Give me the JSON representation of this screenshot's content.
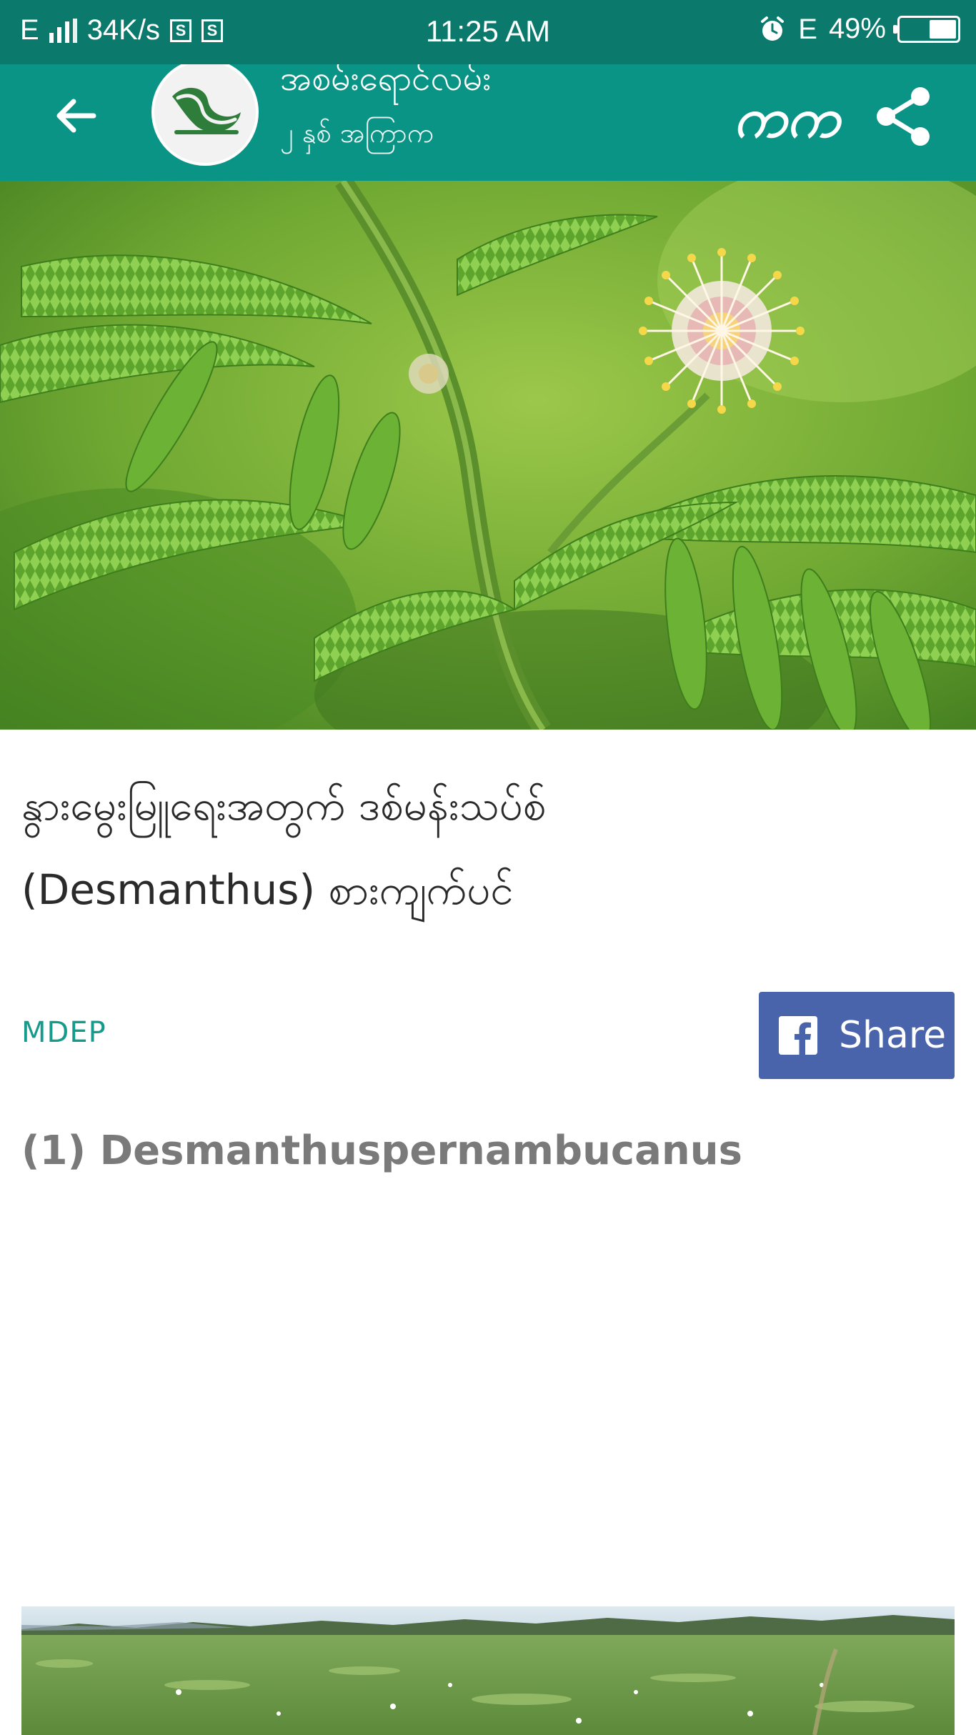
{
  "status_bar": {
    "network_type": "E",
    "speed": "34K/s",
    "sim_label": "S",
    "time": "11:25 AM",
    "data_type": "E",
    "battery_percent": "49%",
    "battery_level": 0.49
  },
  "header": {
    "channel_name": "အစမ်းရောင်လမ်း",
    "channel_meta": "၂ နှစ် အကြာက",
    "font_toggle_label": "ကက"
  },
  "article": {
    "title_line_1": "နွားမွေးမြူရေးအတွက် ဒစ်မန်းသပ်စ်",
    "title_line_2": "(Desmanthus) စားကျက်ပင်",
    "source": "MDEP",
    "share_label": "Share",
    "section_heading": "(1) Desmanthuspernambucanus"
  },
  "colors": {
    "status_bar": "#0b7a6d",
    "app_bar": "#0a9486",
    "accent": "#159a8c",
    "facebook": "#4a64ab"
  },
  "icons": {
    "back": "back-arrow-icon",
    "share": "share-icon",
    "alarm": "alarm-icon",
    "facebook": "facebook-icon"
  }
}
